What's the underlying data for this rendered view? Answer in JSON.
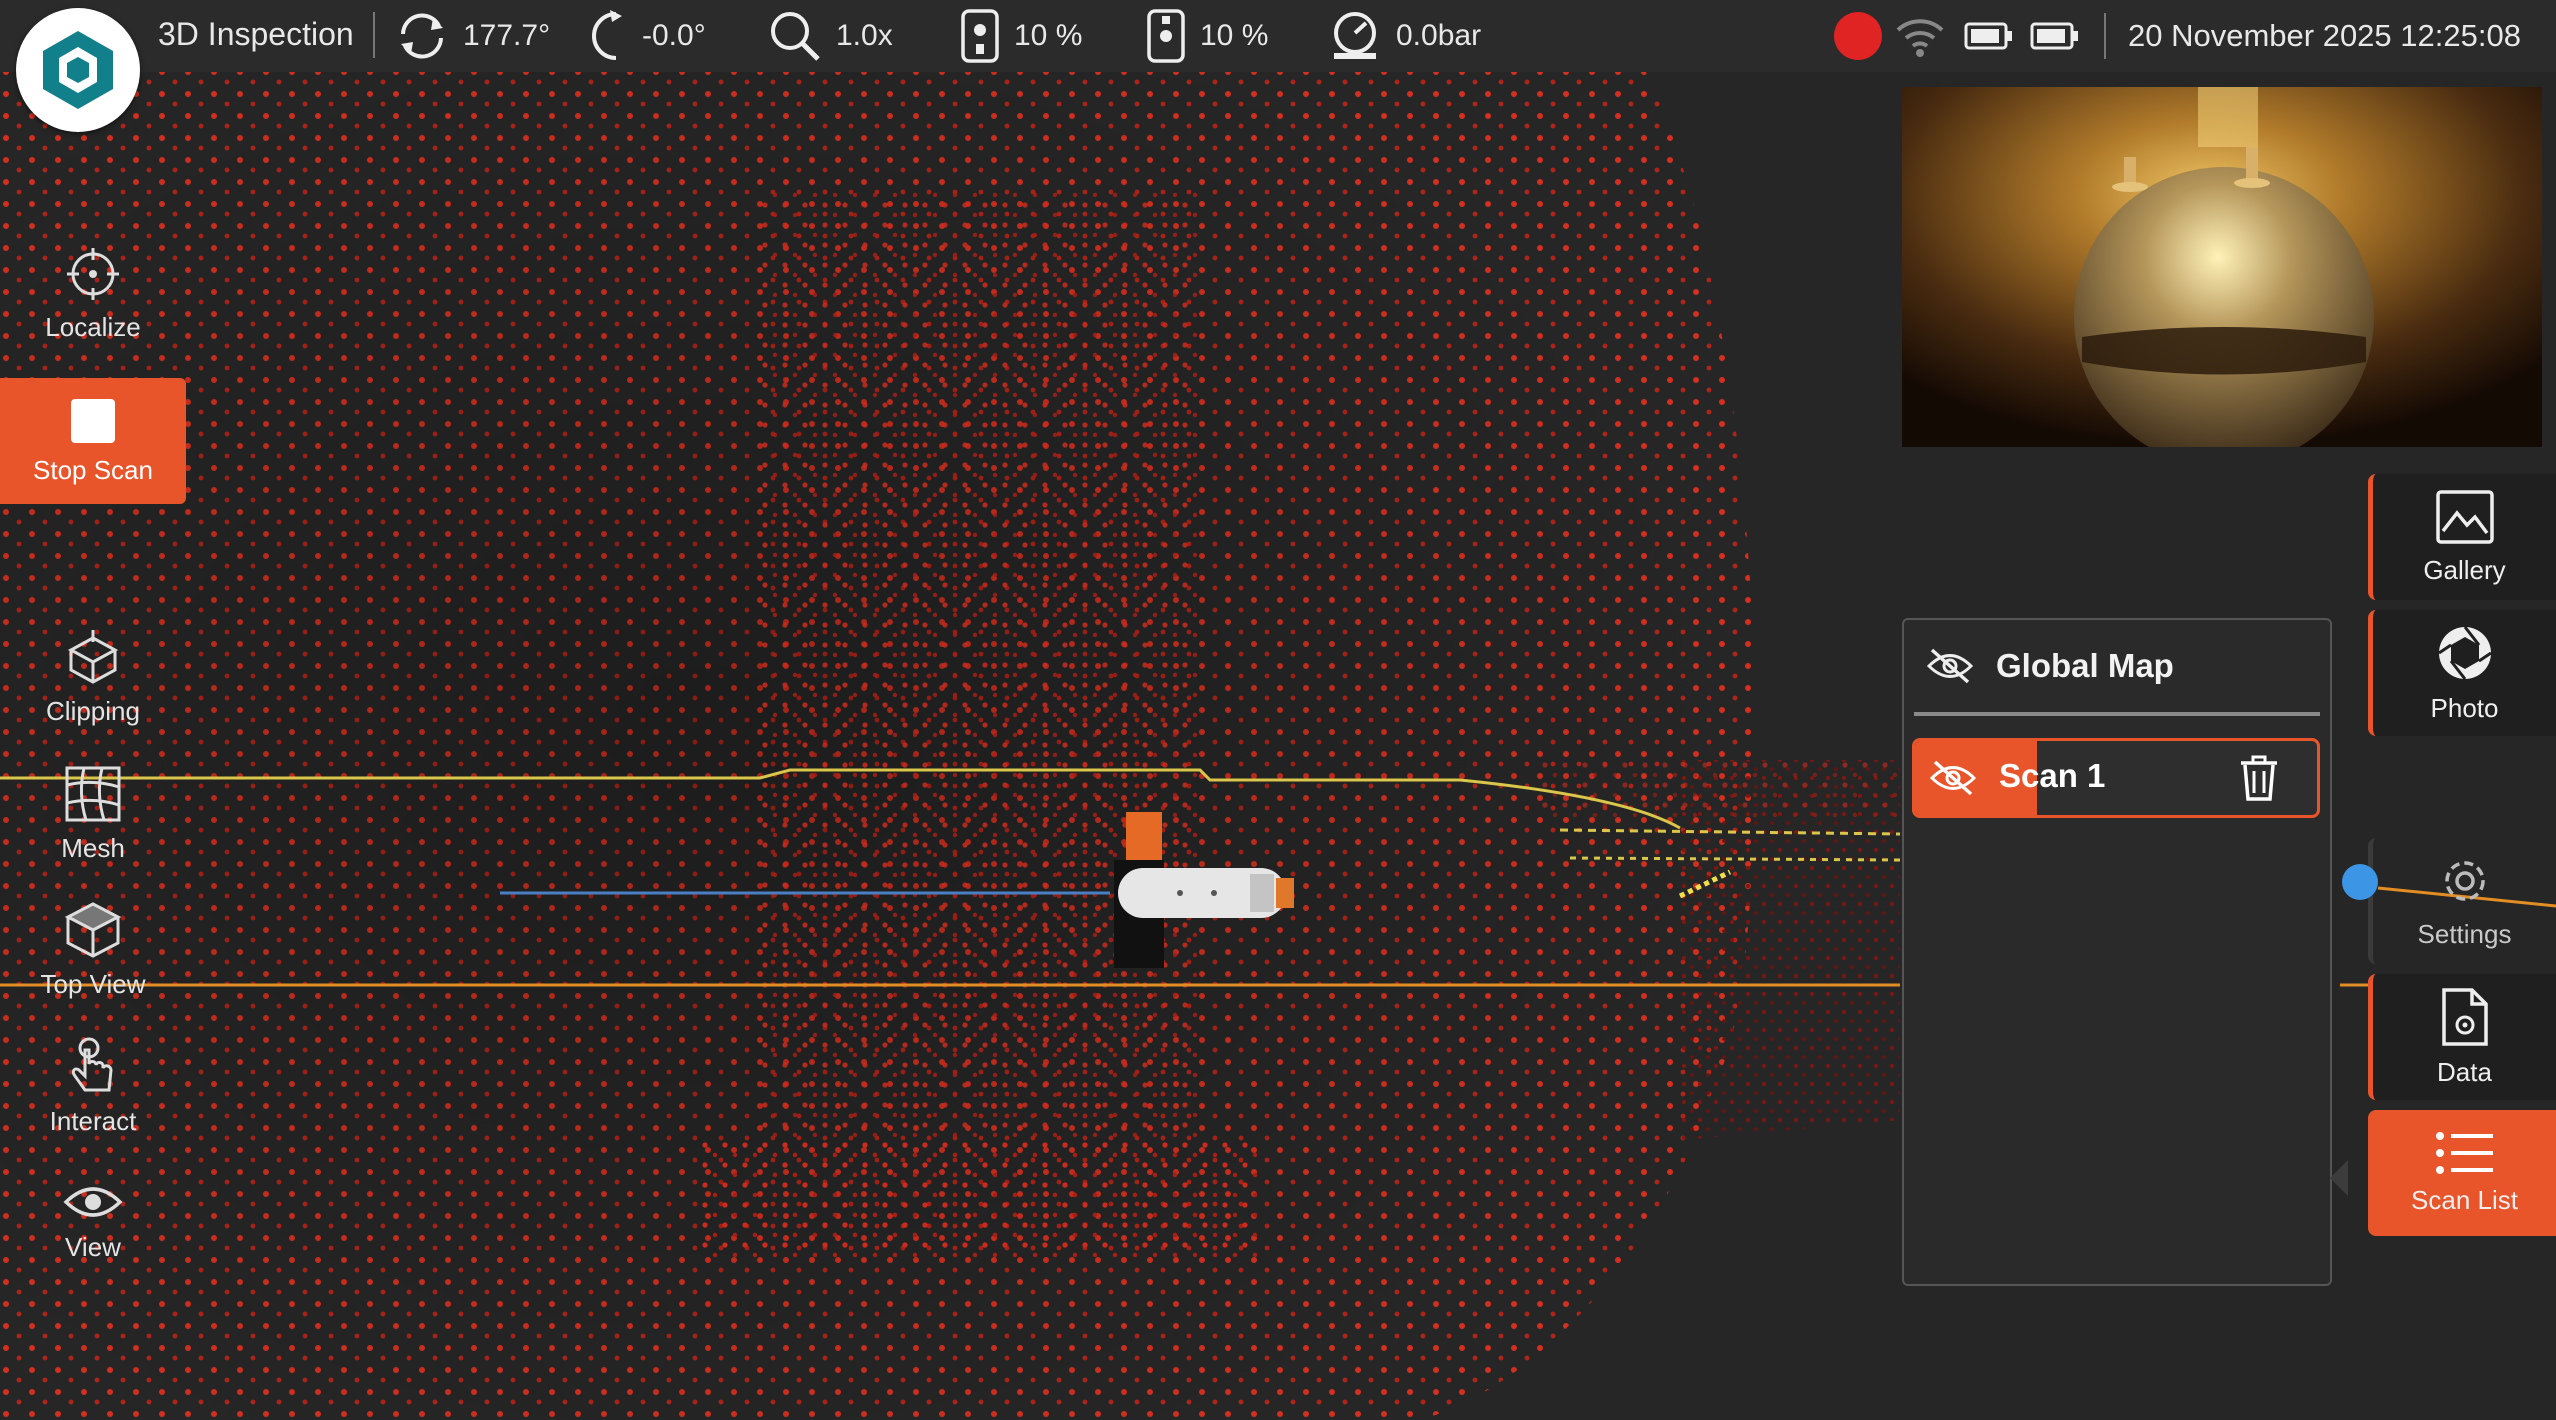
{
  "app": {
    "title": "3D Inspection"
  },
  "status_bar": {
    "rotation": "177.7°",
    "tilt": "-0.0°",
    "zoom": "1.0x",
    "light_front": "10 %",
    "light_rear": "10 %",
    "pressure": "0.0bar",
    "datetime": "20 November 2025 12:25:08",
    "recording": true
  },
  "left_toolbar": {
    "items": [
      {
        "label": "Localize",
        "icon": "crosshair-icon",
        "active": false
      },
      {
        "label": "Stop Scan",
        "icon": "stop-icon",
        "active": true
      },
      {
        "label": "Clipping",
        "icon": "clipping-cube-icon",
        "active": false
      },
      {
        "label": "Mesh",
        "icon": "mesh-icon",
        "active": false
      },
      {
        "label": "Top View",
        "icon": "cube-icon",
        "active": false
      },
      {
        "label": "Interact",
        "icon": "hand-pointer-icon",
        "active": false
      },
      {
        "label": "View",
        "icon": "eye-icon",
        "active": false
      }
    ]
  },
  "scan_panel": {
    "global_map_label": "Global Map",
    "scans": [
      {
        "name": "Scan 1",
        "visible": false,
        "selected": true
      }
    ]
  },
  "right_toolbar": {
    "items": [
      {
        "label": "Gallery",
        "icon": "gallery-icon"
      },
      {
        "label": "Photo",
        "icon": "camera-aperture-icon"
      },
      {
        "label": "Settings",
        "icon": "gear-icon"
      },
      {
        "label": "Data",
        "icon": "data-file-icon"
      },
      {
        "label": "Scan List",
        "icon": "list-icon"
      }
    ]
  },
  "colors": {
    "accent": "#e8552b",
    "point_cloud": "#c0281c",
    "background": "#262626",
    "slider": "#3d95e6"
  }
}
